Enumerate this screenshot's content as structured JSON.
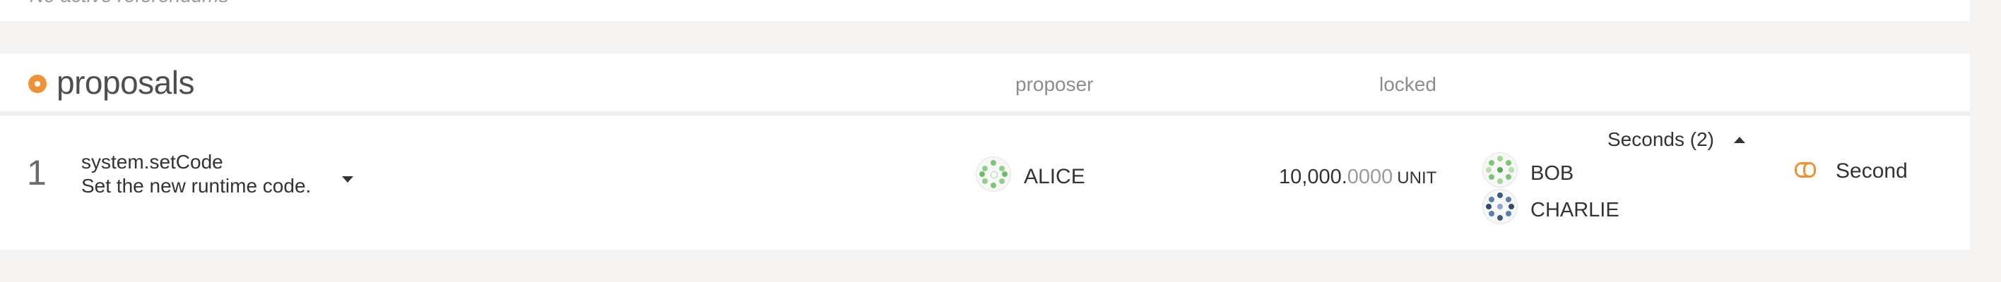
{
  "referenda": {
    "empty_text": "No active referendums"
  },
  "proposals": {
    "title": "proposals",
    "columns": {
      "proposer": "proposer",
      "locked": "locked"
    },
    "items": [
      {
        "index": "1",
        "call": "system.setCode",
        "description": "Set the new runtime code.",
        "proposer": "ALICE",
        "locked_int": "10,000.",
        "locked_dec": "0000",
        "locked_unit": "UNIT",
        "seconds_label": "Seconds (2)",
        "seconds": [
          "BOB",
          "CHARLIE"
        ],
        "action_label": "Second"
      }
    ]
  },
  "colors": {
    "accent": "#f19135",
    "background": "#f4f3f2",
    "card": "#ffffff"
  },
  "icons": {
    "section": "dot-icon",
    "expand": "chevron-down-icon",
    "collapse": "chevron-up-icon",
    "second": "link-icon",
    "identity": "identicon"
  }
}
